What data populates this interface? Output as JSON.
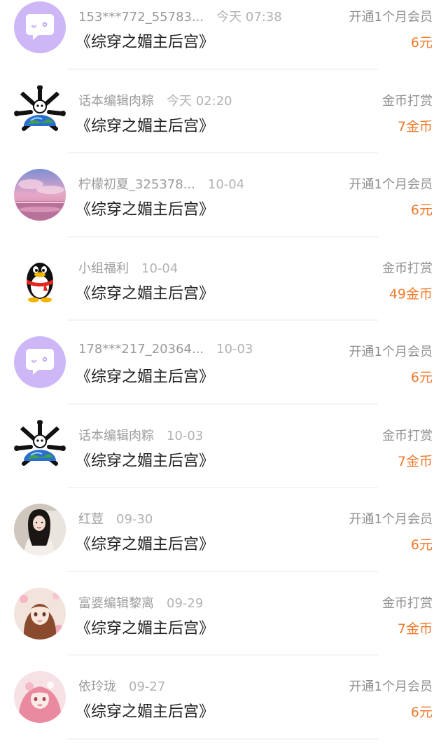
{
  "colors": {
    "amount": "#f07a2c",
    "meta": "#9b9b9b",
    "title": "#222222",
    "chat_avatar_bg": "#cdb7f7"
  },
  "records": [
    {
      "user": "153***772_55783...",
      "time": "今天 07:38",
      "book": "《综穿之媚主后宫》",
      "action": "开通1个月会员",
      "amount": "6元",
      "avatar": "chat-bubble-avatar"
    },
    {
      "user": "话本编辑肉粽",
      "time": "今天 02:20",
      "book": "《综穿之媚主后宫》",
      "action": "金币打赏",
      "amount": "7金币",
      "avatar": "globe-bones-avatar"
    },
    {
      "user": "柠檬初夏_325378...",
      "time": "10-04",
      "book": "《综穿之媚主后宫》",
      "action": "开通1个月会员",
      "amount": "6元",
      "avatar": "pink-sky-avatar"
    },
    {
      "user": "小组福利",
      "time": "10-04",
      "book": "《综穿之媚主后宫》",
      "action": "金币打赏",
      "amount": "49金币",
      "avatar": "penguin-avatar"
    },
    {
      "user": "178***217_20364...",
      "time": "10-03",
      "book": "《综穿之媚主后宫》",
      "action": "开通1个月会员",
      "amount": "6元",
      "avatar": "chat-bubble-avatar"
    },
    {
      "user": "话本编辑肉粽",
      "time": "10-03",
      "book": "《综穿之媚主后宫》",
      "action": "金币打赏",
      "amount": "7金币",
      "avatar": "globe-bones-avatar"
    },
    {
      "user": "红荳",
      "time": "09-30",
      "book": "《综穿之媚主后宫》",
      "action": "开通1个月会员",
      "amount": "6元",
      "avatar": "portrait-woman-avatar"
    },
    {
      "user": "富婆编辑黎离",
      "time": "09-29",
      "book": "《综穿之媚主后宫》",
      "action": "金币打赏",
      "amount": "7金币",
      "avatar": "anime-girl-avatar"
    },
    {
      "user": "依玲珑",
      "time": "09-27",
      "book": "《综穿之媚主后宫》",
      "action": "开通1个月会员",
      "amount": "6元",
      "avatar": "pink-anime-avatar"
    }
  ]
}
